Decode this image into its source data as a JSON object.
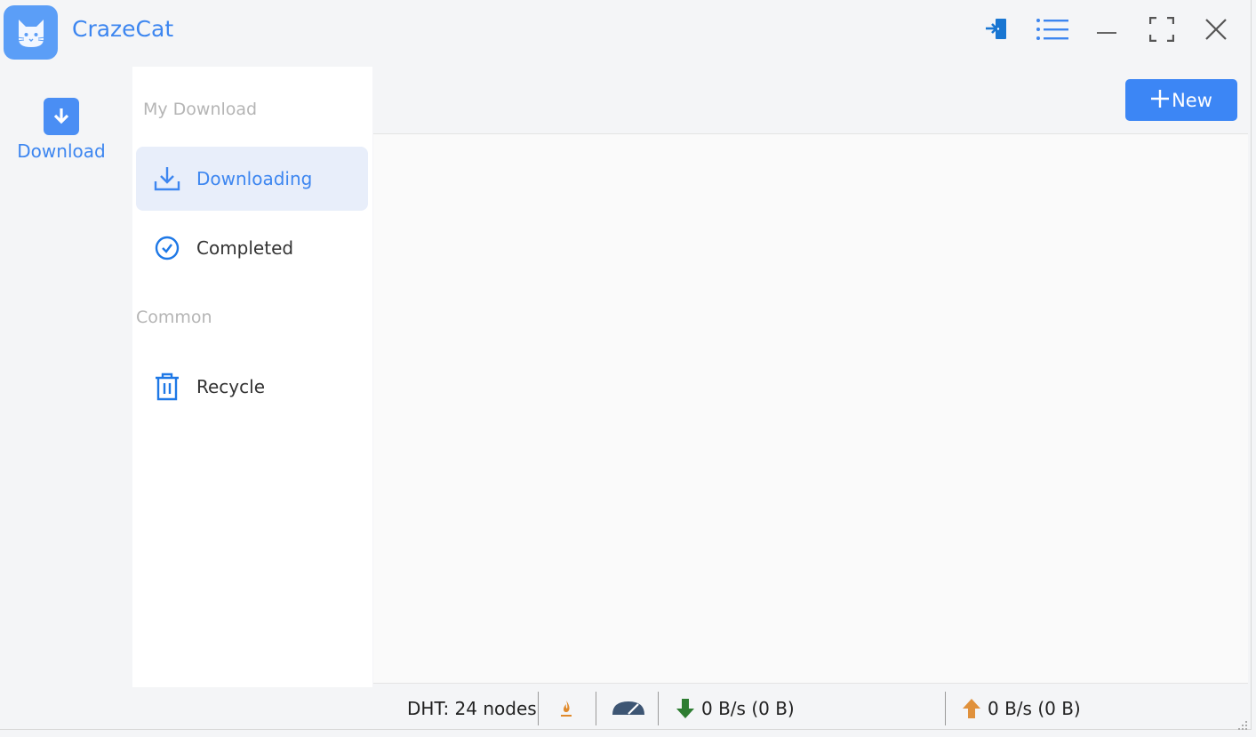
{
  "app": {
    "title": "CrazeCat"
  },
  "rail": {
    "download_label": "Download"
  },
  "sidebar": {
    "section_my_download": "My Download",
    "section_common": "Common",
    "items": [
      {
        "label": "Downloading",
        "icon": "download-tray-icon",
        "active": true
      },
      {
        "label": "Completed",
        "icon": "check-circle-icon",
        "active": false
      },
      {
        "label": "Recycle",
        "icon": "trash-icon",
        "active": false
      }
    ]
  },
  "toolbar": {
    "new_label": "New"
  },
  "status": {
    "dht": "DHT: 24 nodes",
    "download_speed": "0 B/s (0 B)",
    "upload_speed": "0 B/s (0 B)"
  },
  "colors": {
    "accent": "#3c86f5",
    "active_bg": "#e8eefa"
  }
}
